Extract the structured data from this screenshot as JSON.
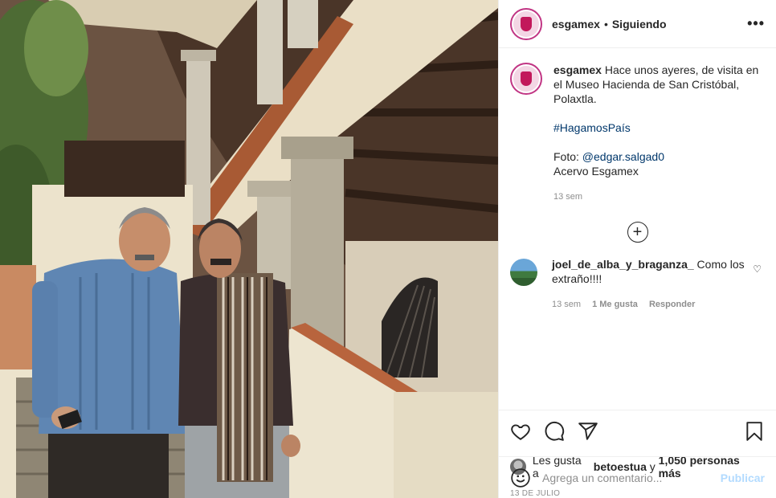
{
  "post": {
    "username": "esgamex",
    "separator": "•",
    "follow_status": "Siguiendo",
    "more_label": "•••"
  },
  "caption": {
    "username": "esgamex",
    "text": "Hace unos ayeres, de visita en el Museo Hacienda de San Cristóbal, Polaxtla.",
    "hashtag": "#HagamosPaís",
    "photo_prefix": "Foto:",
    "mention": "@edgar.salgad0",
    "credit": "Acervo Esgamex",
    "time": "13 sem"
  },
  "load_more_label": "+",
  "comment": {
    "username": "joel_de_alba_y_braganza_",
    "text": "Como los extraño!!!!",
    "time": "13 sem",
    "likes": "1 Me gusta",
    "reply_label": "Responder",
    "heart": "♡"
  },
  "likes": {
    "prefix": "Les gusta a",
    "user": "betoestua",
    "middle": "y",
    "count": "1,050 personas más"
  },
  "date": "13 DE JULIO",
  "add_comment": {
    "placeholder": "Agrega un comentario...",
    "publish_label": "Publicar"
  },
  "colors": {
    "accent": "#c13584",
    "link": "#00376b",
    "muted": "#8e8e8e",
    "publish_disabled": "#b3dbff"
  },
  "icons": {
    "like": "heart-icon",
    "comment": "comment-icon",
    "share": "share-icon",
    "save": "bookmark-icon",
    "emoji": "smiley-icon"
  }
}
